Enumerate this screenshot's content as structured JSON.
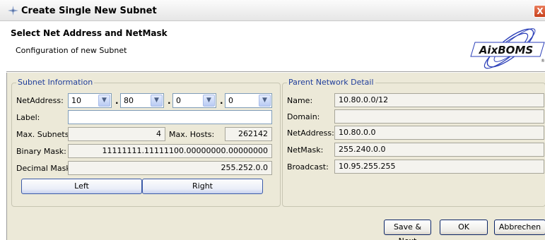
{
  "window": {
    "title": "Create Single New Subnet",
    "close_glyph": "X"
  },
  "header": {
    "title": "Select Net Address and NetMask",
    "subtitle": "Configuration of new Subnet",
    "logo_text": "AixBOMS",
    "logo_mark": "®"
  },
  "subnet_info": {
    "title": "Subnet Information",
    "net_address_label": "NetAddress:",
    "octets": [
      "10",
      "80",
      "0",
      "0"
    ],
    "separator": ".",
    "dropdown_glyph": "▼",
    "label_label": "Label:",
    "label_value": "",
    "max_subnets_label": "Max. Subnets:",
    "max_subnets_value": "4",
    "max_hosts_label": "Max. Hosts:",
    "max_hosts_value": "262142",
    "binary_mask_label": "Binary Mask:",
    "binary_mask_value": "11111111.11111100.00000000.00000000",
    "decimal_mask_label": "Decimal Mask:",
    "decimal_mask_value": "255.252.0.0",
    "left_button": "Left",
    "right_button": "Right"
  },
  "parent_network": {
    "title": "Parent Network Detail",
    "name_label": "Name:",
    "name_value": "10.80.0.0/12",
    "domain_label": "Domain:",
    "domain_value": "",
    "net_address_label": "NetAddress:",
    "net_address_value": "10.80.0.0",
    "netmask_label": "NetMask:",
    "netmask_value": "255.240.0.0",
    "broadcast_label": "Broadcast:",
    "broadcast_value": "10.95.255.255"
  },
  "footer": {
    "save_next": "Save & Next",
    "ok": "OK",
    "cancel": "Abbrechen"
  },
  "colors": {
    "dialog_bg": "#ece9d8",
    "group_title": "#1f3d9a",
    "close_button": "#d3522a",
    "logo_blue": "#2b3fb8"
  },
  "icons": {
    "window_icon": "sparkle-icon",
    "dropdown": "chevron-down-icon"
  }
}
